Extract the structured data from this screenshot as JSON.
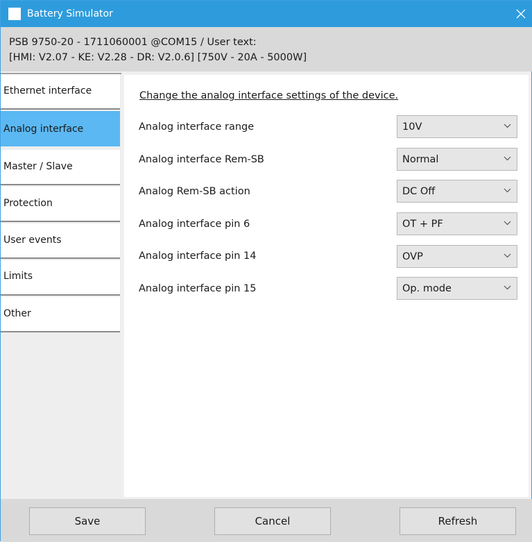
{
  "window": {
    "title": "Battery Simulator",
    "close_icon": "close-icon",
    "accent_color": "#2e9cdc"
  },
  "device_info": {
    "line1": "PSB 9750-20 - 1711060001 @COM15 / User text:",
    "line2": "[HMI: V2.07 - KE: V2.28 - DR: V2.0.6] [750V - 20A - 5000W]"
  },
  "sidebar": {
    "selected_color": "#5bb8f2",
    "items": [
      {
        "label": "Ethernet interface",
        "selected": false
      },
      {
        "label": "Analog interface",
        "selected": true
      },
      {
        "label": "Master / Slave",
        "selected": false
      },
      {
        "label": "Protection",
        "selected": false
      },
      {
        "label": "User events",
        "selected": false
      },
      {
        "label": "Limits",
        "selected": false
      },
      {
        "label": "Other",
        "selected": false
      }
    ]
  },
  "main": {
    "heading": "Change the analog interface settings of the device.",
    "settings": [
      {
        "label": "Analog interface range",
        "value": "10V"
      },
      {
        "label": "Analog interface Rem-SB",
        "value": "Normal"
      },
      {
        "label": "Analog Rem-SB action",
        "value": "DC Off"
      },
      {
        "label": "Analog interface pin 6",
        "value": "OT + PF"
      },
      {
        "label": "Analog interface pin 14",
        "value": "OVP"
      },
      {
        "label": "Analog interface pin 15",
        "value": "Op. mode"
      }
    ]
  },
  "footer": {
    "save_label": "Save",
    "cancel_label": "Cancel",
    "refresh_label": "Refresh"
  }
}
